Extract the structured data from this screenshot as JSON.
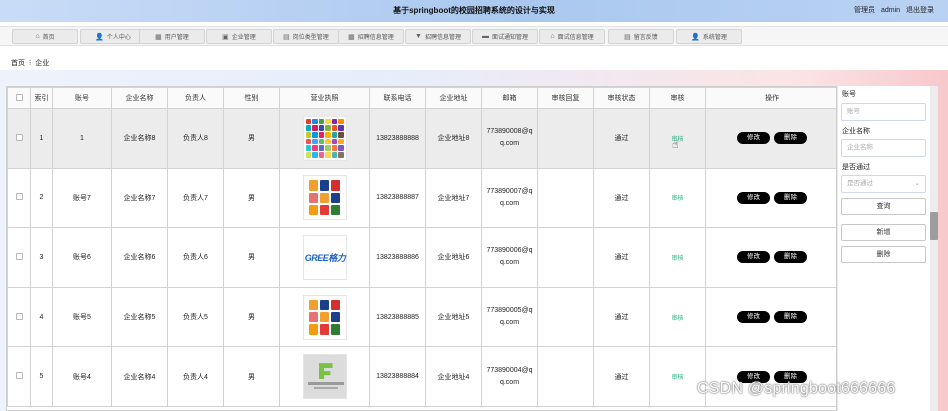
{
  "header": {
    "title": "基于springboot的校园招聘系统的设计与实现",
    "role": "管理员",
    "user": "admin",
    "logout": "退出登录"
  },
  "nav": [
    {
      "label": "首页",
      "icon": "home-icon",
      "glyph": "⌂"
    },
    {
      "label": "个人中心",
      "icon": "user-icon",
      "glyph": "👤"
    },
    {
      "label": "用户管理",
      "icon": "grid-icon",
      "glyph": "▦"
    },
    {
      "label": "企业管理",
      "icon": "building-icon",
      "glyph": "▣"
    },
    {
      "label": "岗位类型管理",
      "icon": "list-icon",
      "glyph": "▤"
    },
    {
      "label": "招聘信息管理",
      "icon": "grid-icon",
      "glyph": "▦"
    },
    {
      "label": "招聘信息管理",
      "icon": "pin-icon",
      "glyph": "▼"
    },
    {
      "label": "面试通知管理",
      "icon": "message-icon",
      "glyph": "▬"
    },
    {
      "label": "面试信息管理",
      "icon": "bank-icon",
      "glyph": "⌂"
    },
    {
      "label": "留言反馈",
      "icon": "list-icon",
      "glyph": "▤"
    },
    {
      "label": "系统管理",
      "icon": "user-icon",
      "glyph": "👤"
    }
  ],
  "breadcrumb": {
    "home": "首页",
    "separator": "⁝",
    "current": "企业"
  },
  "table": {
    "columns": [
      "索引",
      "账号",
      "企业名称",
      "负责人",
      "性别",
      "营业执照",
      "联系电话",
      "企业地址",
      "邮箱",
      "审核回复",
      "审核状态",
      "审核",
      "操作"
    ],
    "review_action": "审核",
    "edit_label": "修改",
    "delete_label": "删除",
    "rows": [
      {
        "index": "1",
        "account": "1",
        "name": "企业名称8",
        "owner": "负责人8",
        "gender": "男",
        "license": "mosaic",
        "phone": "13823888888",
        "address": "企业地址8",
        "email": "773890008@qq.com",
        "reply": "",
        "status": "通过"
      },
      {
        "index": "2",
        "account": "账号7",
        "name": "企业名称7",
        "owner": "负责人7",
        "gender": "男",
        "license": "grid",
        "phone": "13823888887",
        "address": "企业地址7",
        "email": "773890007@qq.com",
        "reply": "",
        "status": "通过"
      },
      {
        "index": "3",
        "account": "账号6",
        "name": "企业名称6",
        "owner": "负责人6",
        "gender": "男",
        "license": "gree",
        "phone": "13823888886",
        "address": "企业地址6",
        "email": "773890006@qq.com",
        "reply": "",
        "status": "通过"
      },
      {
        "index": "4",
        "account": "账号5",
        "name": "企业名称5",
        "owner": "负责人5",
        "gender": "男",
        "license": "grid",
        "phone": "13823888885",
        "address": "企业地址5",
        "email": "773890005@qq.com",
        "reply": "",
        "status": "通过"
      },
      {
        "index": "5",
        "account": "账号4",
        "name": "企业名称4",
        "owner": "负责人4",
        "gender": "男",
        "license": "fallen",
        "phone": "13823888884",
        "address": "企业地址4",
        "email": "773890004@qq.com",
        "reply": "",
        "status": "通过"
      }
    ]
  },
  "logos": {
    "gree_text": "GREE格力"
  },
  "search": {
    "account_label": "账号",
    "account_placeholder": "账号",
    "company_label": "企业名称",
    "company_placeholder": "企业名称",
    "passed_label": "是否通过",
    "passed_placeholder": "是否通过",
    "query_button": "查询",
    "add_button": "新增",
    "delete_button": "删除"
  },
  "watermark": "CSDN @springboot666666",
  "colors": {
    "header_bg": "#aac8ef",
    "review_link": "#2bb07f",
    "op_button": "#000000"
  }
}
